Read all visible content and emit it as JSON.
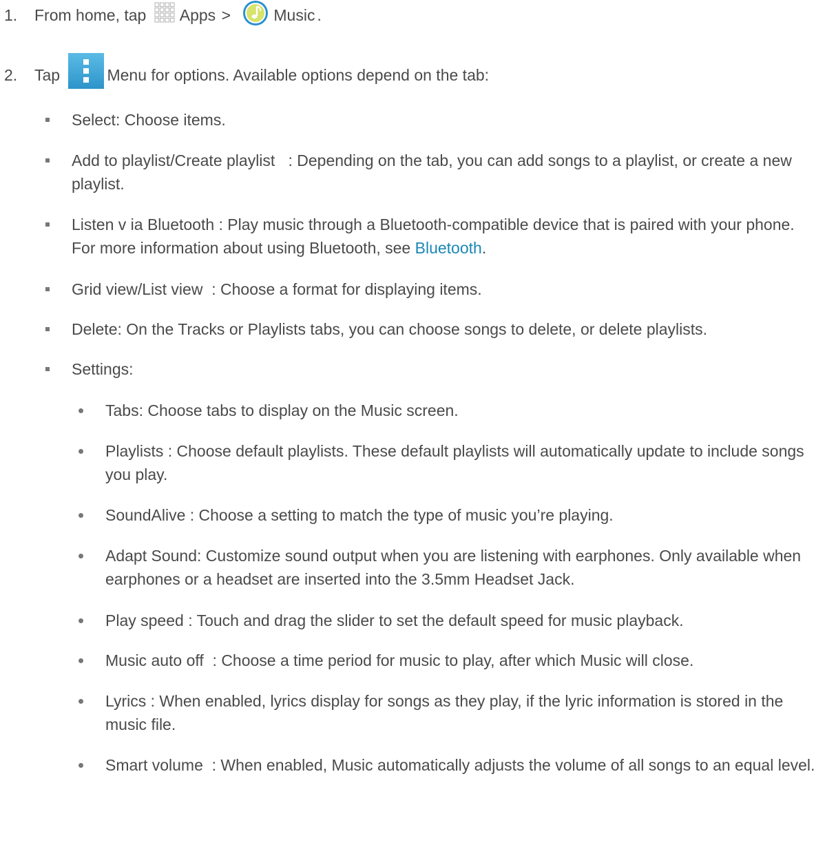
{
  "step1": {
    "number": "1.",
    "prefix": "From home, tap",
    "apps_label": "Apps",
    "separator": ">",
    "music_label": "Music",
    "suffix": "."
  },
  "step2": {
    "number": "2.",
    "prefix": "Tap",
    "menu_label": "Menu",
    "suffix": "for options. Available options depend on the tab:"
  },
  "options": [
    {
      "term": "Select",
      "text": ": Choose items."
    },
    {
      "term": "Add to playlist/Create playlist",
      "text": "   : Depending on the tab, you can add songs to a playlist, or create a new playlist."
    },
    {
      "term": "Listen v ia Bluetooth",
      "text": " : Play music through a Bluetooth-compatible device that is paired with your phone. For more information about using Bluetooth, see ",
      "link": "Bluetooth",
      "after": "."
    },
    {
      "term": "Grid view/List view",
      "text": "  : Choose a format for displaying items."
    },
    {
      "term": "Delete",
      "text": ": On the Tracks or Playlists tabs, you can choose songs to delete, or delete playlists."
    },
    {
      "term": "Settings",
      "text": ":"
    }
  ],
  "settings": [
    {
      "term": "Tabs",
      "text": ": Choose tabs to display on the Music screen."
    },
    {
      "term": "Playlists",
      "text": " : Choose default playlists. These default playlists will automatically update to include songs you play."
    },
    {
      "term": "SoundAlive",
      "text": " : Choose a setting to match the type of music you’re playing."
    },
    {
      "term": "Adapt Sound",
      "text": ": Customize sound output when you are listening with earphones. Only available when earphones or a headset are inserted into the 3.5mm Headset Jack."
    },
    {
      "term": "Play speed",
      "text": " : Touch and drag the slider to set the default speed for music playback."
    },
    {
      "term": "Music auto off",
      "text": "  : Choose a time period for music to play, after which Music will close."
    },
    {
      "term": "Lyrics",
      "text": " : When enabled, lyrics display for songs as they play, if the lyric information is stored in the music file."
    },
    {
      "term": "Smart volume",
      "text": "  : When enabled, Music automatically adjusts the volume of all songs to an equal level."
    }
  ],
  "icons": {
    "apps": "apps-grid-icon",
    "music": "music-note-icon",
    "menu": "menu-dots-icon"
  },
  "colors": {
    "text": "#4a4a4a",
    "link": "#1a87b5",
    "menu_icon": "#3aa6d8",
    "music_icon": "#2a8fd0"
  }
}
